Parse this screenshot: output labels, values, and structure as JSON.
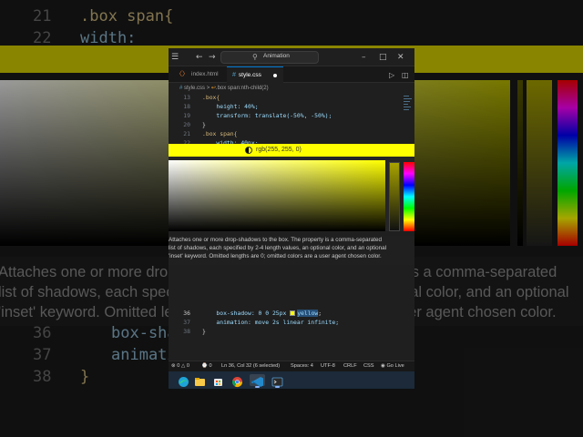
{
  "background": {
    "code_lines": [
      {
        "ln": "21",
        "text": ".box span{"
      },
      {
        "ln": "22",
        "text": "    width:"
      },
      {
        "ln": "36",
        "text": "    box-sha"
      },
      {
        "ln": "37",
        "text": "    animati"
      },
      {
        "ln": "38",
        "text": "}"
      }
    ],
    "hover_lines": [
      "Attaches one or more drop-shadows to the box. The property is a comma-separated",
      "list of shadows, each specified by 2-4 length values, an optional color, and an optional",
      "'inset' keyword. Omitted lengths are 0; omitted colors are a user agent chosen color."
    ]
  },
  "window": {
    "title": "Animation",
    "tabs": [
      {
        "label": "index.html",
        "active": false
      },
      {
        "label": "style.css",
        "active": true,
        "dirty": true
      }
    ],
    "breadcrumb": {
      "file": "style.css",
      "separator": ">",
      "symbol": ".box span:nth-child(2)"
    }
  },
  "editor": {
    "lines": [
      {
        "ln": "13",
        "text": ".box{"
      },
      {
        "ln": "18",
        "text": "    height: 40%;"
      },
      {
        "ln": "19",
        "text": "    transform: translate(-50%, -50%);"
      },
      {
        "ln": "20",
        "text": "}"
      },
      {
        "ln": "21",
        "text": ".box span{"
      },
      {
        "ln": "22",
        "text": "    width: 40px;"
      },
      {
        "ln": "36",
        "text_before": "    box-shadow: 0 0 25px ",
        "selected": "yellow",
        "text_after": ";"
      },
      {
        "ln": "37",
        "text": "    animation: move 2s linear infinite;"
      },
      {
        "ln": "38",
        "text": "}"
      }
    ]
  },
  "color_picker": {
    "value": "rgb(255, 255, 0)",
    "color": "#ffff00"
  },
  "hover": {
    "lines": [
      "Attaches one or more drop-shadows to the box. The property is a comma-separated",
      "list of shadows, each specified by 2-4 length values, an optional color, and an optional",
      "'inset' keyword. Omitted lengths are 0; omitted colors are a user agent chosen color."
    ]
  },
  "statusbar": {
    "errors": "0",
    "warnings": "0",
    "info": "0",
    "position": "Ln 36, Col 32 (6 selected)",
    "spaces": "Spaces: 4",
    "encoding": "UTF-8",
    "eol": "CRLF",
    "language": "CSS",
    "golive": "Go Live"
  },
  "taskbar": {
    "apps": [
      "edge-icon",
      "file-explorer-icon",
      "store-icon",
      "chrome-icon",
      "vscode-icon",
      "terminal-icon"
    ]
  },
  "colors": {
    "accent": "#0078d4",
    "yellow": "#ffff00",
    "editor_bg": "#1f1f1f"
  }
}
